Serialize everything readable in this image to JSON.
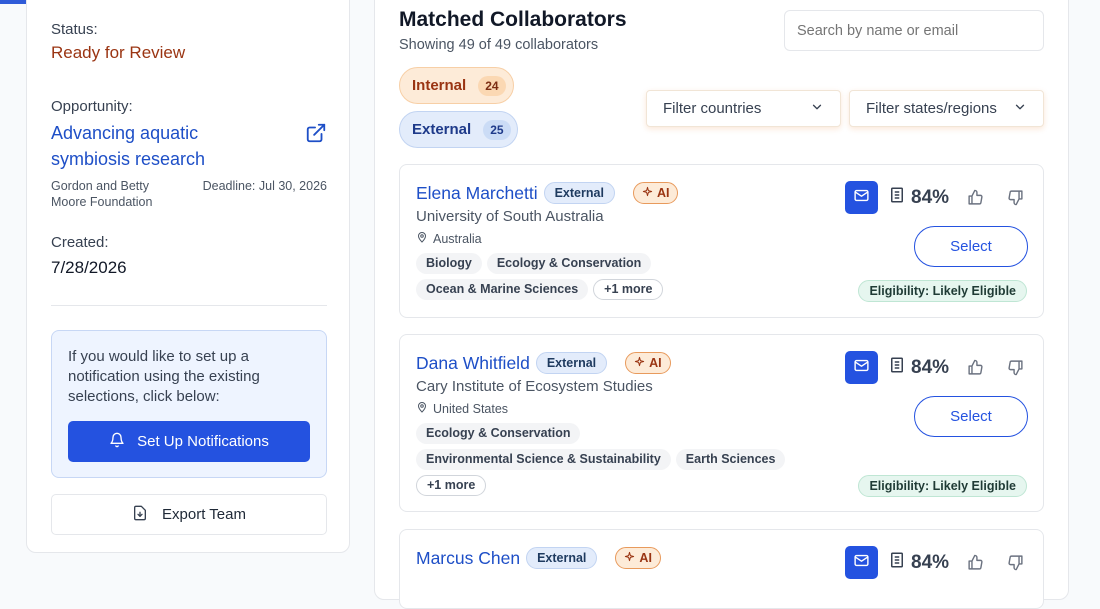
{
  "left": {
    "status_label": "Status:",
    "status_value": "Ready for Review",
    "opportunity_label": "Opportunity:",
    "opportunity_title": "Advancing aquatic symbiosis research",
    "funder": "Gordon and Betty Moore Foundation",
    "deadline": "Deadline: Jul 30, 2026",
    "created_label": "Created:",
    "created_value": "7/28/2026",
    "notify_text": "If you would like to set up a notification using the existing selections, click below:",
    "notify_button": "Set Up Notifications",
    "export_button": "Export Team"
  },
  "main": {
    "title": "Matched Collaborators",
    "subtitle": "Showing 49 of 49 collaborators",
    "search_placeholder": "Search by name or email",
    "pills": [
      {
        "label": "Internal",
        "count": "24"
      },
      {
        "label": "External",
        "count": "25"
      }
    ],
    "filters": {
      "countries": "Filter countries",
      "states": "Filter states/regions"
    }
  },
  "cards": [
    {
      "name": "Elena Marchetti",
      "badge": "External",
      "ai": "AI",
      "institution": "University of South Australia",
      "location": "Australia",
      "tags": [
        "Biology",
        "Ecology & Conservation",
        "Ocean & Marine Sciences"
      ],
      "more": "+1 more",
      "score": "84%",
      "select": "Select",
      "eligibility": "Eligibility: Likely Eligible"
    },
    {
      "name": "Dana Whitfield",
      "badge": "External",
      "ai": "AI",
      "institution": "Cary Institute of Ecosystem Studies",
      "location": "United States",
      "tags": [
        "Ecology & Conservation",
        "Environmental Science & Sustainability",
        "Earth Sciences"
      ],
      "more": "+1 more",
      "score": "84%",
      "select": "Select",
      "eligibility": "Eligibility: Likely Eligible"
    },
    {
      "name": "Marcus Chen",
      "badge": "External",
      "ai": "AI",
      "score": "84%"
    }
  ],
  "colors": {
    "primary": "#2452e0",
    "link": "#1e4fc7",
    "status": "#9a3412"
  }
}
